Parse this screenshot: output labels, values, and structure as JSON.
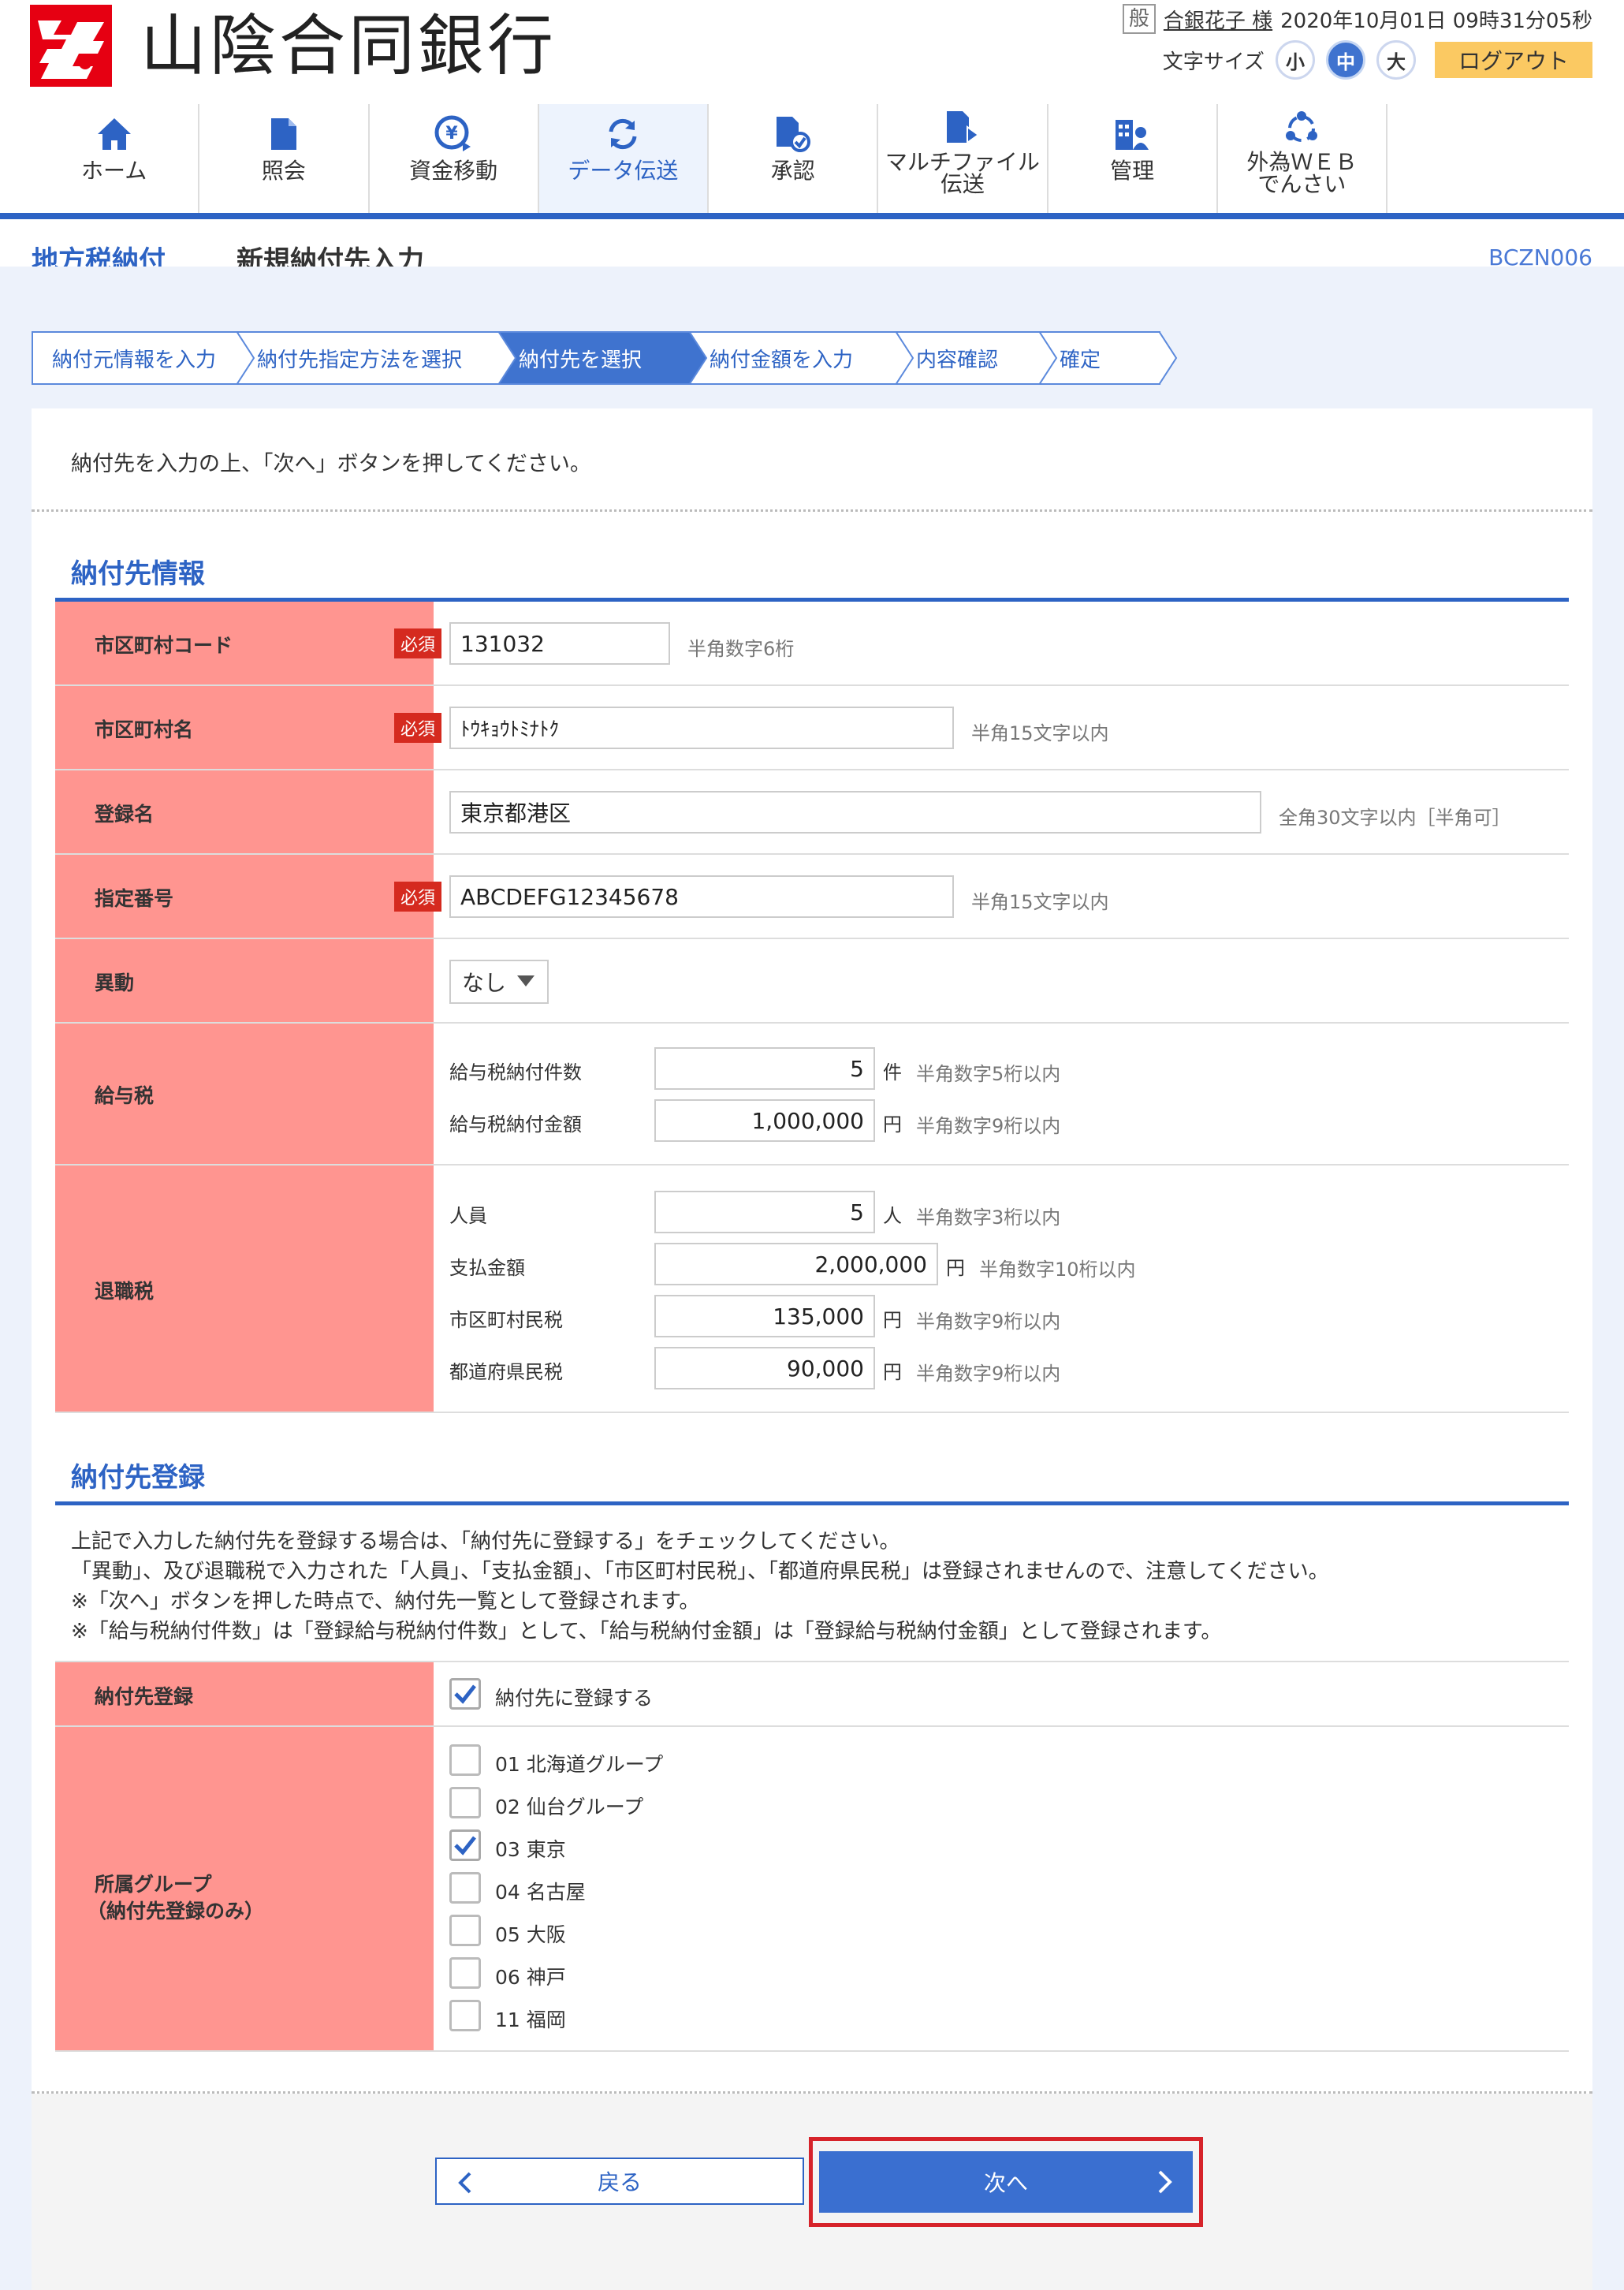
{
  "header": {
    "bank_name": "山陰合同銀行",
    "user_badge": "般",
    "user_name": "合銀花子 様",
    "datetime": "2020年10月01日 09時31分05秒",
    "font_size_label": "文字サイズ",
    "font_sizes": [
      "小",
      "中",
      "大"
    ],
    "logout_label": "ログアウト"
  },
  "nav": {
    "items": [
      {
        "label": "ホーム",
        "icon": "home-icon"
      },
      {
        "label": "照会",
        "icon": "document-icon"
      },
      {
        "label": "資金移動",
        "icon": "yen-transfer-icon"
      },
      {
        "label": "データ伝送",
        "icon": "refresh-icon"
      },
      {
        "label": "承認",
        "icon": "approve-icon"
      },
      {
        "label": "マルチファイル\n伝送",
        "icon": "file-upload-icon"
      },
      {
        "label": "管理",
        "icon": "admin-icon"
      },
      {
        "label": "外為ＷＥＢ\nでんさい",
        "icon": "network-icon"
      }
    ],
    "active_index": 3
  },
  "page": {
    "category": "地方税納付",
    "title": "新規納付先入力",
    "screen_id": "BCZN006"
  },
  "steps": [
    "納付元情報を入力",
    "納付先指定方法を選択",
    "納付先を選択",
    "納付金額を入力",
    "内容確認",
    "確定"
  ],
  "current_step_index": 2,
  "instruction": "納付先を入力の上、「次へ」ボタンを押してください。",
  "payee_info": {
    "section_title": "納付先情報",
    "required_label": "必須",
    "city_code": {
      "label": "市区町村コード",
      "value": "131032",
      "hint": "半角数字6桁"
    },
    "city_name": {
      "label": "市区町村名",
      "value": "ﾄｳｷｮｳﾄﾐﾅﾄｸ",
      "hint": "半角15文字以内"
    },
    "registered_name": {
      "label": "登録名",
      "value": "東京都港区",
      "hint": "全角30文字以内［半角可］"
    },
    "designated_number": {
      "label": "指定番号",
      "value": "ABCDEFG12345678",
      "hint": "半角15文字以内"
    },
    "transfer": {
      "label": "異動",
      "value": "なし"
    },
    "salary_tax": {
      "label": "給与税",
      "count": {
        "label": "給与税納付件数",
        "value": "5",
        "unit": "件",
        "hint": "半角数字5桁以内"
      },
      "amount": {
        "label": "給与税納付金額",
        "value": "1,000,000",
        "unit": "円",
        "hint": "半角数字9桁以内"
      }
    },
    "retirement_tax": {
      "label": "退職税",
      "persons": {
        "label": "人員",
        "value": "5",
        "unit": "人",
        "hint": "半角数字3桁以内"
      },
      "payment": {
        "label": "支払金額",
        "value": "2,000,000",
        "unit": "円",
        "hint": "半角数字10桁以内"
      },
      "municipal": {
        "label": "市区町村民税",
        "value": "135,000",
        "unit": "円",
        "hint": "半角数字9桁以内"
      },
      "prefectural": {
        "label": "都道府県民税",
        "value": "90,000",
        "unit": "円",
        "hint": "半角数字9桁以内"
      }
    }
  },
  "payee_registration": {
    "section_title": "納付先登録",
    "notes": [
      "上記で入力した納付先を登録する場合は、「納付先に登録する」をチェックしてください。",
      "「異動」、及び退職税で入力された「人員」、「支払金額」、「市区町村民税」、「都道府県民税」は登録されませんので、注意してください。",
      "※「次へ」ボタンを押した時点で、納付先一覧として登録されます。",
      "※「給与税納付件数」は「登録給与税納付件数」として、「給与税納付金額」は「登録給与税納付金額」として登録されます。"
    ],
    "register": {
      "label": "納付先登録",
      "checkbox_label": "納付先に登録する",
      "checked": true
    },
    "groups": {
      "label_line1": "所属グループ",
      "label_line2": "（納付先登録のみ）",
      "items": [
        {
          "label": "01 北海道グループ",
          "checked": false
        },
        {
          "label": "02 仙台グループ",
          "checked": false
        },
        {
          "label": "03 東京",
          "checked": true
        },
        {
          "label": "04 名古屋",
          "checked": false
        },
        {
          "label": "05 大阪",
          "checked": false
        },
        {
          "label": "06 神戸",
          "checked": false
        },
        {
          "label": "11 福岡",
          "checked": false
        }
      ]
    }
  },
  "buttons": {
    "back": "戻る",
    "next": "次へ"
  },
  "colors": {
    "primary": "#2d63c4",
    "label_bg": "#ff9590",
    "required": "#d52a1f",
    "logout": "#fbc962",
    "highlight": "#d6232a"
  }
}
